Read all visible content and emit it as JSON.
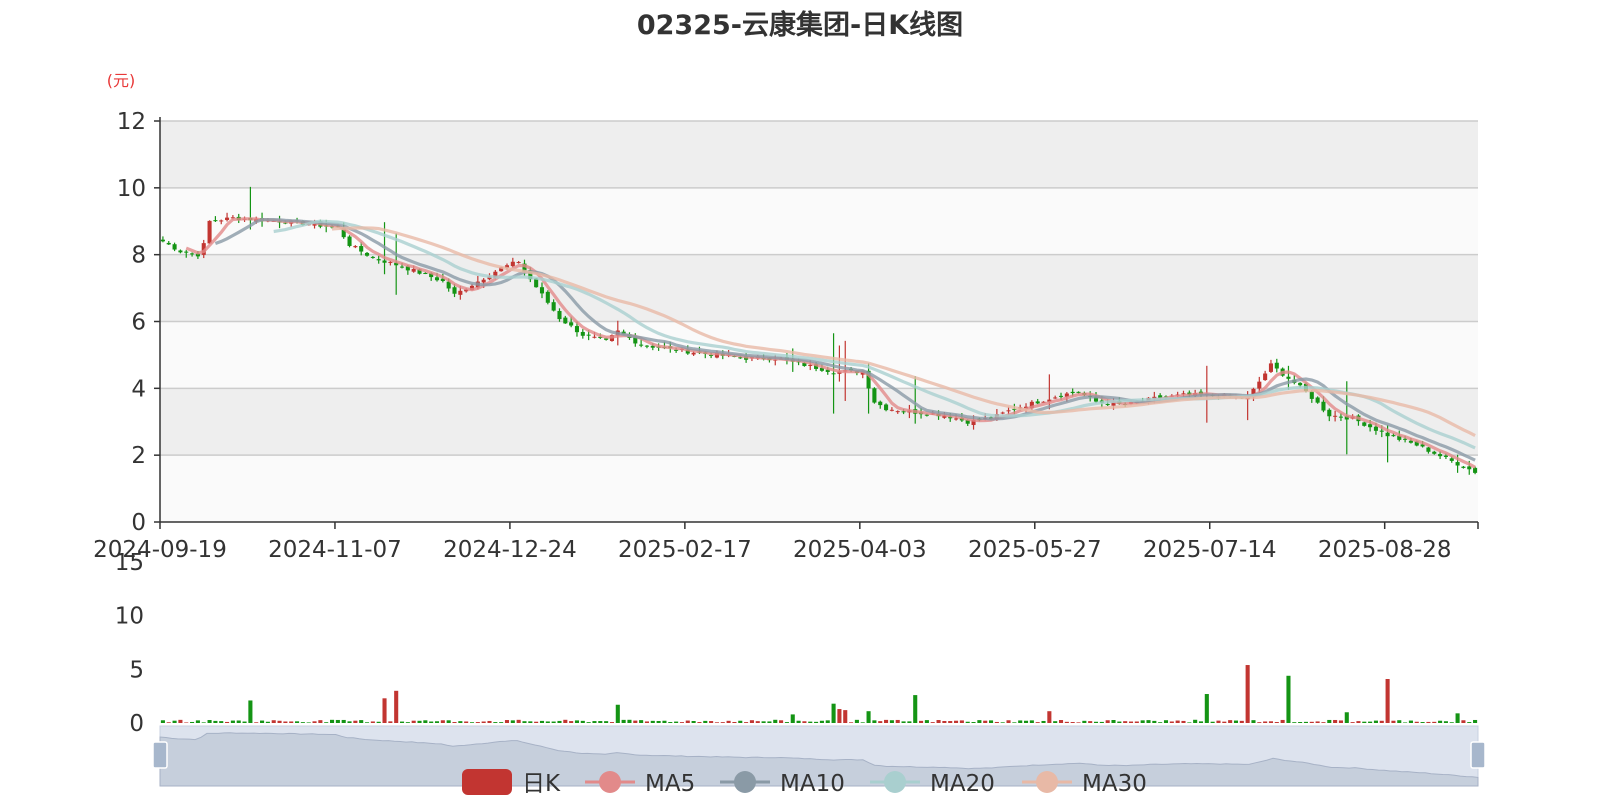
{
  "chart_data": {
    "type": "candlestick",
    "title": "02325-云康集团-日K线图",
    "price_axis": {
      "unit": "(元)",
      "ylim": [
        0,
        12
      ],
      "ticks": [
        "0",
        "2",
        "4",
        "6",
        "8",
        "10",
        "12"
      ],
      "grid": true,
      "banded_background": true
    },
    "volume_axis": {
      "ylim": [
        0,
        15
      ],
      "ticks": [
        "0",
        "5",
        "10",
        "15"
      ]
    },
    "x_axis": {
      "tick_labels": [
        "2024-09-19",
        "2024-11-07",
        "2024-12-24",
        "2025-02-17",
        "2025-04-03",
        "2025-05-27",
        "2025-07-14",
        "2025-08-28"
      ],
      "tick_index": [
        0,
        30,
        60,
        90,
        120,
        150,
        180,
        210
      ],
      "n_days": 226
    },
    "colors": {
      "up": "#c23531",
      "down": "#149414",
      "MA5": "#e28a8a",
      "MA10": "#8a9aa6",
      "MA20": "#a9cfcf",
      "MA30": "#e8b9a6",
      "grid": "#cccccc",
      "band": "#eeeeee",
      "zoom_fill": "#dde3ee"
    },
    "legend": {
      "items": [
        "日K",
        "MA5",
        "MA10",
        "MA20",
        "MA30"
      ],
      "position": "bottom"
    },
    "anchors": [
      [
        0,
        8.4
      ],
      [
        3,
        8.1
      ],
      [
        6,
        8.0
      ],
      [
        7,
        8.3
      ],
      [
        8,
        9.0
      ],
      [
        12,
        9.1
      ],
      [
        20,
        9.0
      ],
      [
        26,
        8.9
      ],
      [
        30,
        8.8
      ],
      [
        32,
        8.3
      ],
      [
        36,
        7.9
      ],
      [
        40,
        7.7
      ],
      [
        45,
        7.4
      ],
      [
        48,
        7.2
      ],
      [
        50,
        6.8
      ],
      [
        54,
        7.2
      ],
      [
        58,
        7.6
      ],
      [
        61,
        7.8
      ],
      [
        62,
        7.5
      ],
      [
        65,
        6.8
      ],
      [
        68,
        6.1
      ],
      [
        72,
        5.6
      ],
      [
        76,
        5.4
      ],
      [
        78,
        5.7
      ],
      [
        82,
        5.3
      ],
      [
        90,
        5.1
      ],
      [
        100,
        4.9
      ],
      [
        105,
        4.9
      ],
      [
        110,
        4.7
      ],
      [
        115,
        4.5
      ],
      [
        120,
        4.5
      ],
      [
        122,
        3.6
      ],
      [
        124,
        3.4
      ],
      [
        128,
        3.3
      ],
      [
        134,
        3.2
      ],
      [
        138,
        3.0
      ],
      [
        142,
        3.1
      ],
      [
        146,
        3.4
      ],
      [
        150,
        3.6
      ],
      [
        154,
        3.8
      ],
      [
        157,
        3.9
      ],
      [
        160,
        3.6
      ],
      [
        165,
        3.5
      ],
      [
        170,
        3.7
      ],
      [
        175,
        3.8
      ],
      [
        180,
        3.8
      ],
      [
        186,
        3.7
      ],
      [
        188,
        4.2
      ],
      [
        190,
        4.7
      ],
      [
        193,
        4.3
      ],
      [
        196,
        3.9
      ],
      [
        200,
        3.2
      ],
      [
        204,
        3.1
      ],
      [
        210,
        2.6
      ],
      [
        215,
        2.3
      ],
      [
        220,
        1.9
      ],
      [
        225,
        1.5
      ]
    ],
    "volume_spikes": [
      [
        15,
        2.1,
        "down"
      ],
      [
        38,
        2.3,
        "up"
      ],
      [
        40,
        3.0,
        "up"
      ],
      [
        78,
        1.7,
        "down"
      ],
      [
        108,
        0.8,
        "down"
      ],
      [
        115,
        1.8,
        "down"
      ],
      [
        116,
        1.3,
        "up"
      ],
      [
        117,
        1.2,
        "up"
      ],
      [
        121,
        1.1,
        "down"
      ],
      [
        129,
        2.6,
        "down"
      ],
      [
        152,
        1.1,
        "up"
      ],
      [
        179,
        2.7,
        "down"
      ],
      [
        186,
        5.4,
        "up"
      ],
      [
        193,
        4.4,
        "down"
      ],
      [
        203,
        1.0,
        "down"
      ],
      [
        210,
        4.1,
        "up"
      ],
      [
        222,
        0.9,
        "down"
      ]
    ]
  }
}
